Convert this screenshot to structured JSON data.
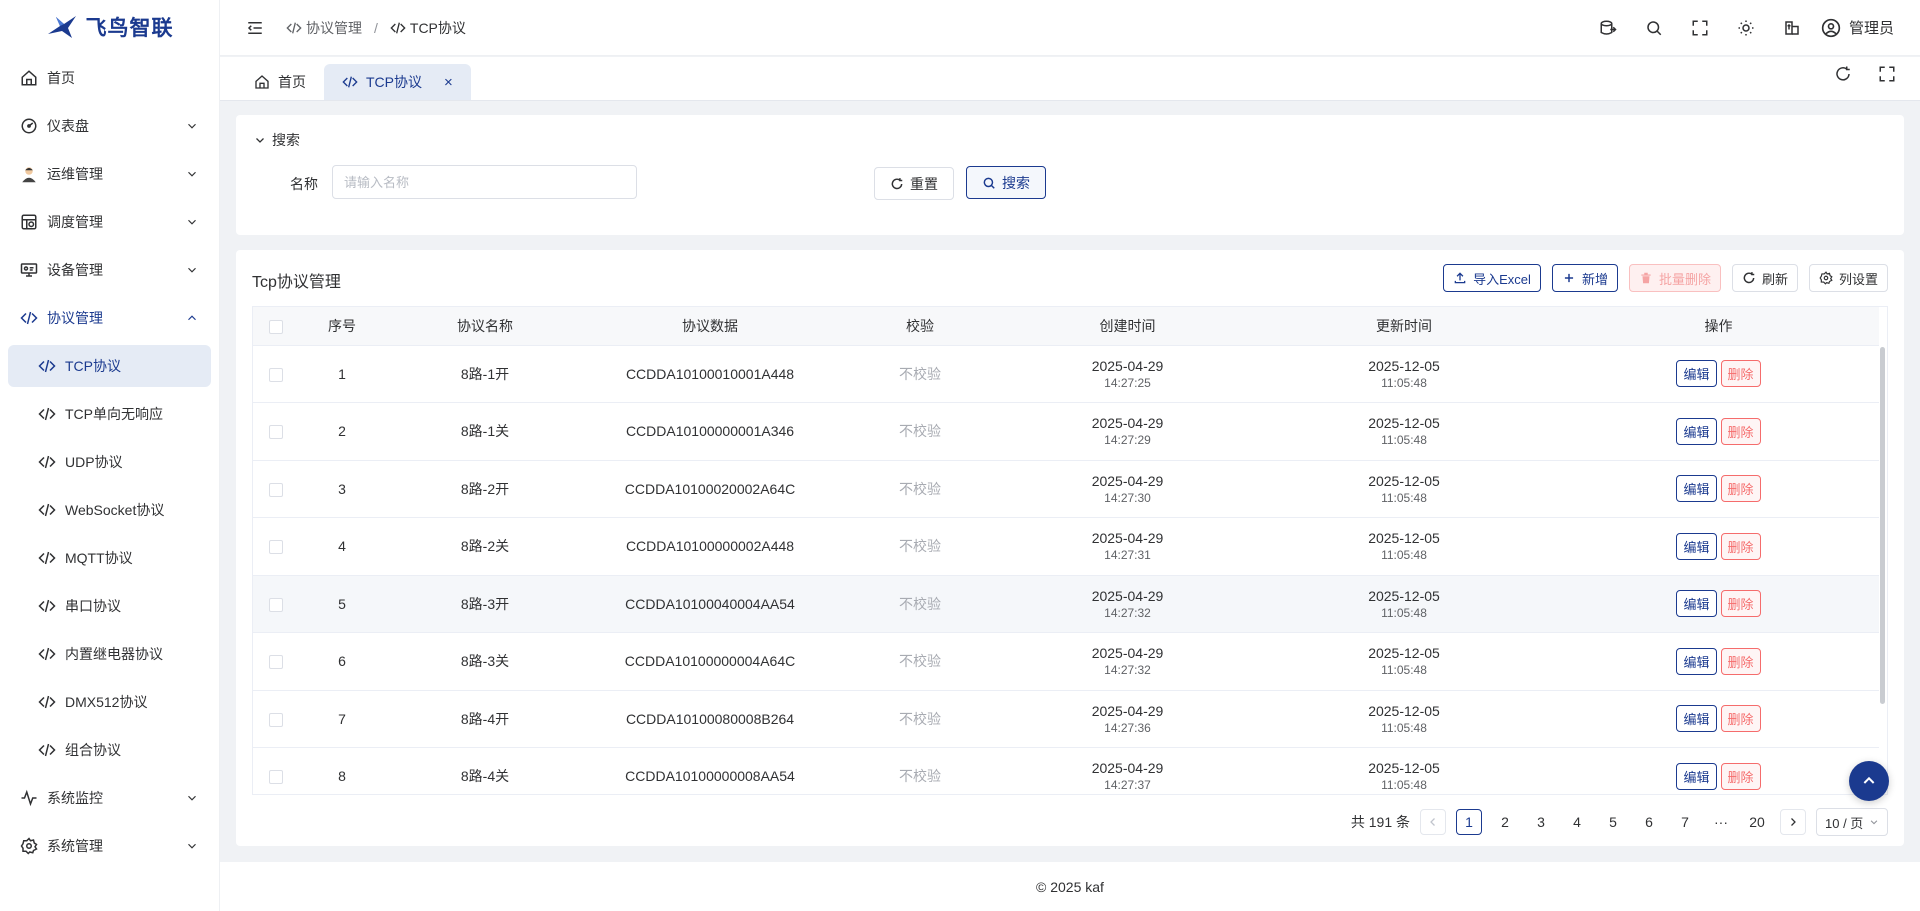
{
  "brand": {
    "name": "飞鸟智联"
  },
  "sidebar": {
    "items": [
      {
        "label": "首页",
        "icon": "home-icon"
      },
      {
        "label": "仪表盘",
        "icon": "dashboard-icon"
      },
      {
        "label": "运维管理",
        "icon": "user-avatar-icon"
      },
      {
        "label": "调度管理",
        "icon": "schedule-icon"
      },
      {
        "label": "设备管理",
        "icon": "device-icon"
      },
      {
        "label": "协议管理",
        "icon": "code-icon"
      },
      {
        "label": "系统监控",
        "icon": "pulse-icon"
      },
      {
        "label": "系统管理",
        "icon": "gear-icon"
      }
    ],
    "protocol_sub": [
      "TCP协议",
      "TCP单向无响应",
      "UDP协议",
      "WebSocket协议",
      "MQTT协议",
      "串口协议",
      "内置继电器协议",
      "DMX512协议",
      "组合协议"
    ]
  },
  "header": {
    "breadcrumb": [
      "协议管理",
      "TCP协议"
    ],
    "user": "管理员"
  },
  "tabs": [
    {
      "label": "首页"
    },
    {
      "label": "TCP协议",
      "close": "×"
    }
  ],
  "search": {
    "title": "搜索",
    "name_label": "名称",
    "name_placeholder": "请输入名称",
    "reset_label": "重置",
    "search_label": "搜索"
  },
  "table": {
    "title": "Tcp协议管理",
    "tools": {
      "import": "导入Excel",
      "add": "新增",
      "batch_delete": "批量删除",
      "refresh": "刷新",
      "columns": "列设置"
    },
    "columns": [
      "序号",
      "协议名称",
      "协议数据",
      "校验",
      "创建时间",
      "更新时间",
      "操作"
    ],
    "rows": [
      {
        "no": "1",
        "name": "8路-1开",
        "data": "CCDDA10100010001A448",
        "check": "不校验",
        "created_date": "2025-04-29",
        "created_time": "14:27:25",
        "updated_date": "2025-12-05",
        "updated_time": "11:05:48"
      },
      {
        "no": "2",
        "name": "8路-1关",
        "data": "CCDDA10100000001A346",
        "check": "不校验",
        "created_date": "2025-04-29",
        "created_time": "14:27:29",
        "updated_date": "2025-12-05",
        "updated_time": "11:05:48"
      },
      {
        "no": "3",
        "name": "8路-2开",
        "data": "CCDDA10100020002A64C",
        "check": "不校验",
        "created_date": "2025-04-29",
        "created_time": "14:27:30",
        "updated_date": "2025-12-05",
        "updated_time": "11:05:48"
      },
      {
        "no": "4",
        "name": "8路-2关",
        "data": "CCDDA10100000002A448",
        "check": "不校验",
        "created_date": "2025-04-29",
        "created_time": "14:27:31",
        "updated_date": "2025-12-05",
        "updated_time": "11:05:48"
      },
      {
        "no": "5",
        "name": "8路-3开",
        "data": "CCDDA10100040004AA54",
        "check": "不校验",
        "created_date": "2025-04-29",
        "created_time": "14:27:32",
        "updated_date": "2025-12-05",
        "updated_time": "11:05:48"
      },
      {
        "no": "6",
        "name": "8路-3关",
        "data": "CCDDA10100000004A64C",
        "check": "不校验",
        "created_date": "2025-04-29",
        "created_time": "14:27:32",
        "updated_date": "2025-12-05",
        "updated_time": "11:05:48"
      },
      {
        "no": "7",
        "name": "8路-4开",
        "data": "CCDDA10100080008B264",
        "check": "不校验",
        "created_date": "2025-04-29",
        "created_time": "14:27:36",
        "updated_date": "2025-12-05",
        "updated_time": "11:05:48"
      },
      {
        "no": "8",
        "name": "8路-4关",
        "data": "CCDDA10100000008AA54",
        "check": "不校验",
        "created_date": "2025-04-29",
        "created_time": "14:27:37",
        "updated_date": "2025-12-05",
        "updated_time": "11:05:48"
      }
    ],
    "edit_label": "编辑",
    "delete_label": "删除"
  },
  "pagination": {
    "total": "共 191 条",
    "pages": [
      "1",
      "2",
      "3",
      "4",
      "5",
      "6",
      "7",
      "···",
      "20"
    ],
    "current": "1",
    "page_size": "10 / 页"
  },
  "footer": "© 2025 kaf",
  "colors": {
    "primary": "#1b3a8f",
    "danger": "#f56c6c",
    "active_bg": "#e5ebf5"
  }
}
